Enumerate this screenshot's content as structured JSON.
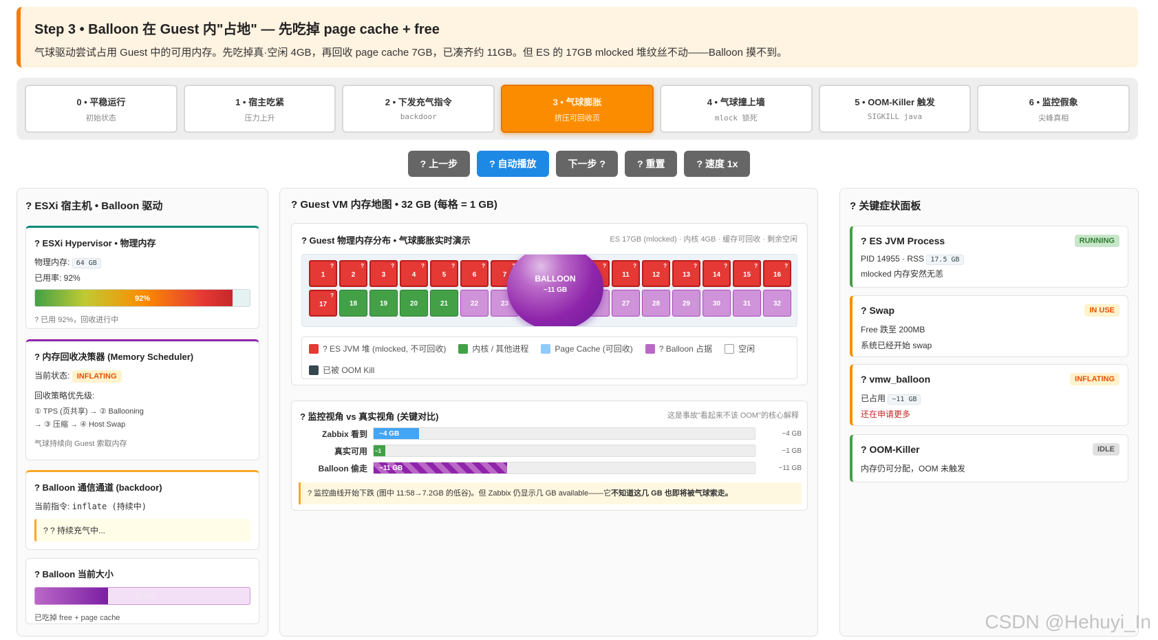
{
  "banner": {
    "title": "Step 3 • Balloon 在 Guest 内\"占地\" — 先吃掉 page cache + free",
    "desc": "气球驱动尝试占用 Guest 中的可用内存。先吃掉真·空闲 4GB，再回收 page cache 7GB，已凑齐约 11GB。但 ES 的 17GB mlocked 堆纹丝不动——Balloon 摸不到。"
  },
  "steps": [
    {
      "title": "0 • 平稳运行",
      "sub": "初始状态"
    },
    {
      "title": "1 • 宿主吃紧",
      "sub": "压力上升"
    },
    {
      "title": "2 • 下发充气指令",
      "sub": "backdoor"
    },
    {
      "title": "3 • 气球膨胀",
      "sub": "挤压可回收页"
    },
    {
      "title": "4 • 气球撞上墙",
      "sub": "mlock 锁死"
    },
    {
      "title": "5 • OOM-Killer 触发",
      "sub": "SIGKILL java"
    },
    {
      "title": "6 • 监控假象",
      "sub": "尖峰真相"
    }
  ],
  "controls": {
    "prev": "? 上一步",
    "auto": "? 自动播放",
    "next": "下一步 ?",
    "reset": "? 重置",
    "speed": "? 速度 1x"
  },
  "left": {
    "title": "? ESXi 宿主机 • Balloon 驱动",
    "hyper": {
      "title": "? ESXi Hypervisor • 物理内存",
      "phys_label": "物理内存:",
      "phys_value": "64 GB",
      "usage": "已用率: 92%",
      "bar_label": "92%",
      "bar_pct": 92,
      "note": "? 已用 92%，回收进行中"
    },
    "sched": {
      "title": "? 内存回收决策器 (Memory Scheduler)",
      "state_label": "当前状态:",
      "state": "INFLATING",
      "prio_title": "回收策略优先级:",
      "prio1": "① TPS (页共享) → ② Ballooning",
      "prio2": "→ ③ 压缩 → ④ Host Swap",
      "note": "气球持续向 Guest 索取内存"
    },
    "channel": {
      "title": "? Balloon 通信通道 (backdoor)",
      "cmd_label": "当前指令:",
      "cmd": "inflate (持续中)",
      "status": "? ? 持续充气中..."
    },
    "size": {
      "title": "? Balloon 当前大小",
      "bar_label": "~11 GB",
      "bar_pct": 34,
      "note": "已吃掉 free + page cache"
    }
  },
  "mid": {
    "title": "? Guest VM 内存地图 • 32 GB (每格 = 1 GB)",
    "map": {
      "title": "? Guest 物理内存分布 • 气球膨胀实时演示",
      "hint": "ES 17GB (mlocked) · 内核 4GB · 缓存可回收 · 剩余空闲",
      "balloon_title": "BALLOON",
      "balloon_size": "~11 GB",
      "row1": [
        "1",
        "2",
        "3",
        "4",
        "5",
        "6",
        "7",
        "8",
        "9",
        "10",
        "11",
        "12",
        "13",
        "14",
        "15",
        "16"
      ],
      "row2": [
        "17",
        "18",
        "19",
        "20",
        "21",
        "22",
        "23",
        "24",
        "25",
        "26",
        "27",
        "28",
        "29",
        "30",
        "31",
        "32"
      ],
      "row1_types": [
        "es",
        "es",
        "es",
        "es",
        "es",
        "es",
        "es",
        "es",
        "es",
        "es",
        "es",
        "es",
        "es",
        "es",
        "es",
        "es"
      ],
      "row2_types": [
        "es",
        "k",
        "k",
        "k",
        "k",
        "b",
        "b",
        "b",
        "b",
        "b",
        "b",
        "b",
        "b",
        "b",
        "b",
        "b"
      ],
      "cell_mark": "?"
    },
    "legend": [
      {
        "label": "? ES JVM 堆 (mlocked, 不可回收)",
        "color": "#e53935"
      },
      {
        "label": "内核 / 其他进程",
        "color": "#43a047"
      },
      {
        "label": "Page Cache (可回收)",
        "color": "#90caf9"
      },
      {
        "label": "? Balloon 占据",
        "color": "#ba68c8"
      },
      {
        "label": "空闲",
        "color": "#ffffff"
      },
      {
        "label": "已被 OOM Kill",
        "color": "#37474f"
      }
    ],
    "compare": {
      "title": "? 监控视角 vs 真实视角 (关键对比)",
      "hint": "这是事故\"看起来不该 OOM\"的核心解释",
      "rows": [
        {
          "label": "Zabbix 看到",
          "bar": "~4 GB",
          "value": "~4 GB",
          "pct": 12,
          "color": "#42a5f5"
        },
        {
          "label": "真实可用",
          "bar": "~1",
          "value": "~1 GB",
          "pct": 3,
          "color": "#43a047"
        },
        {
          "label": "Balloon 偷走",
          "bar": "~11 GB",
          "value": "~11 GB",
          "pct": 35,
          "color": "#8e24aa"
        }
      ],
      "note_a": "? 监控曲线开始下跌 (图中 11:58→7.2GB 的低谷)。但 Zabbix 仍显示几 GB available——它",
      "note_b": "不知道这几 GB 也即将被气球索走。"
    }
  },
  "right": {
    "title": "? 关键症状面板",
    "jvm": {
      "name": "? ES JVM Process",
      "badge": "RUNNING",
      "pid": "PID 14955 · RSS",
      "rss": "17.5 GB",
      "note": "mlocked 内存安然无恙"
    },
    "swap": {
      "name": "? Swap",
      "badge": "IN USE",
      "line1": "Free 跌至 200MB",
      "line2": "系统已经开始 swap"
    },
    "balloon": {
      "name": "? vmw_balloon",
      "badge": "INFLATING",
      "used_label": "已占用",
      "used": "~11 GB",
      "warn": "还在申请更多"
    },
    "oom": {
      "name": "? OOM-Killer",
      "badge": "IDLE",
      "note": "内存仍可分配，OOM 未触发"
    }
  },
  "watermark": "CSDN @Hehuyi_In"
}
